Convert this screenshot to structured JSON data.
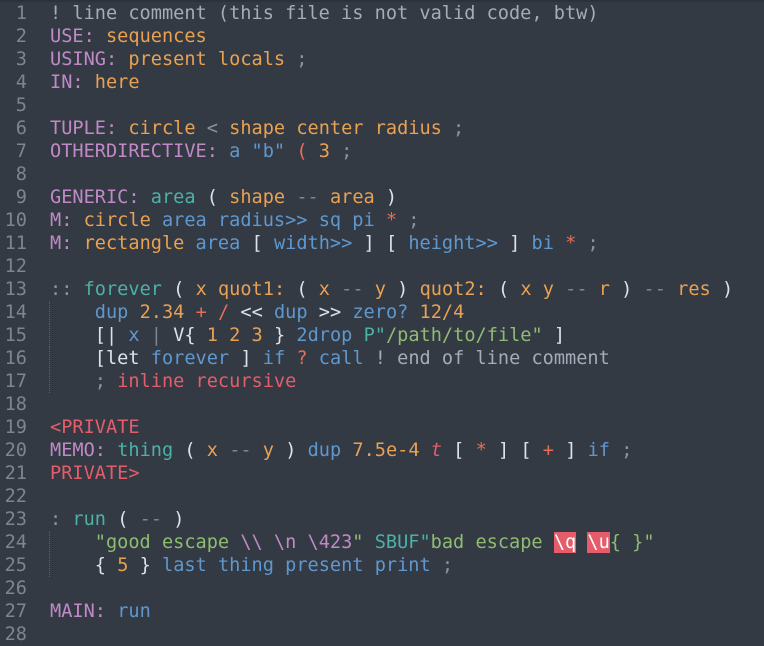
{
  "editor": {
    "theme_colors": {
      "background": "#343a44",
      "line_number": "#7d8590",
      "comment": "#a3acb8",
      "directive": "#c08ac6",
      "vocab": "#e9a152",
      "word": "#5f98cf",
      "definition_name": "#4cb1a8",
      "string": "#8fbc72",
      "operator": "#e66e59",
      "private": "#e55d6a",
      "bad_escape_bg": "#e55d6a"
    },
    "lines": [
      {
        "n": "1",
        "tokens": [
          {
            "t": "! line comment (this file is not valid code, btw)",
            "c": "comment"
          }
        ]
      },
      {
        "n": "2",
        "tokens": [
          {
            "t": "USE:",
            "c": "directive"
          },
          {
            "t": " ",
            "c": "plain"
          },
          {
            "t": "sequences",
            "c": "vocab"
          }
        ]
      },
      {
        "n": "3",
        "tokens": [
          {
            "t": "USING:",
            "c": "directive"
          },
          {
            "t": " ",
            "c": "plain"
          },
          {
            "t": "present locals",
            "c": "vocab"
          },
          {
            "t": " ;",
            "c": "dim"
          }
        ]
      },
      {
        "n": "4",
        "tokens": [
          {
            "t": "IN:",
            "c": "directive"
          },
          {
            "t": " ",
            "c": "plain"
          },
          {
            "t": "here",
            "c": "vocab"
          }
        ]
      },
      {
        "n": "5",
        "tokens": []
      },
      {
        "n": "6",
        "tokens": [
          {
            "t": "TUPLE:",
            "c": "directive"
          },
          {
            "t": " ",
            "c": "plain"
          },
          {
            "t": "circle",
            "c": "vocab"
          },
          {
            "t": " < ",
            "c": "dim"
          },
          {
            "t": "shape",
            "c": "vocab"
          },
          {
            "t": " ",
            "c": "plain"
          },
          {
            "t": "center radius",
            "c": "vocab"
          },
          {
            "t": " ;",
            "c": "dim"
          }
        ]
      },
      {
        "n": "7",
        "tokens": [
          {
            "t": "OTHERDIRECTIVE:",
            "c": "directive"
          },
          {
            "t": " ",
            "c": "plain"
          },
          {
            "t": "a",
            "c": "word"
          },
          {
            "t": " ",
            "c": "plain"
          },
          {
            "t": "\"b\"",
            "c": "word"
          },
          {
            "t": " ",
            "c": "plain"
          },
          {
            "t": "(",
            "c": "op"
          },
          {
            "t": " ",
            "c": "plain"
          },
          {
            "t": "3",
            "c": "number"
          },
          {
            "t": " ;",
            "c": "dim"
          }
        ]
      },
      {
        "n": "8",
        "tokens": []
      },
      {
        "n": "9",
        "tokens": [
          {
            "t": "GENERIC:",
            "c": "directive"
          },
          {
            "t": " ",
            "c": "plain"
          },
          {
            "t": "area",
            "c": "defname"
          },
          {
            "t": " ",
            "c": "plain"
          },
          {
            "t": "(",
            "c": "punct"
          },
          {
            "t": " ",
            "c": "plain"
          },
          {
            "t": "shape",
            "c": "stack"
          },
          {
            "t": " ",
            "c": "plain"
          },
          {
            "t": "--",
            "c": "dashes"
          },
          {
            "t": " ",
            "c": "plain"
          },
          {
            "t": "area",
            "c": "stack"
          },
          {
            "t": " ",
            "c": "plain"
          },
          {
            "t": ")",
            "c": "punct"
          }
        ]
      },
      {
        "n": "10",
        "tokens": [
          {
            "t": "M:",
            "c": "directive"
          },
          {
            "t": " ",
            "c": "plain"
          },
          {
            "t": "circle",
            "c": "vocab"
          },
          {
            "t": " ",
            "c": "plain"
          },
          {
            "t": "area radius>> sq pi",
            "c": "word"
          },
          {
            "t": " ",
            "c": "plain"
          },
          {
            "t": "*",
            "c": "op"
          },
          {
            "t": " ;",
            "c": "dim"
          }
        ]
      },
      {
        "n": "11",
        "tokens": [
          {
            "t": "M:",
            "c": "directive"
          },
          {
            "t": " ",
            "c": "plain"
          },
          {
            "t": "rectangle",
            "c": "vocab"
          },
          {
            "t": " ",
            "c": "plain"
          },
          {
            "t": "area",
            "c": "word"
          },
          {
            "t": " ",
            "c": "plain"
          },
          {
            "t": "[",
            "c": "punct"
          },
          {
            "t": " ",
            "c": "plain"
          },
          {
            "t": "width>>",
            "c": "word"
          },
          {
            "t": " ",
            "c": "plain"
          },
          {
            "t": "]",
            "c": "punct"
          },
          {
            "t": " ",
            "c": "plain"
          },
          {
            "t": "[",
            "c": "punct"
          },
          {
            "t": " ",
            "c": "plain"
          },
          {
            "t": "height>>",
            "c": "word"
          },
          {
            "t": " ",
            "c": "plain"
          },
          {
            "t": "]",
            "c": "punct"
          },
          {
            "t": " ",
            "c": "plain"
          },
          {
            "t": "bi",
            "c": "word"
          },
          {
            "t": " ",
            "c": "plain"
          },
          {
            "t": "*",
            "c": "op"
          },
          {
            "t": " ;",
            "c": "dim"
          }
        ]
      },
      {
        "n": "12",
        "tokens": []
      },
      {
        "n": "13",
        "tokens": [
          {
            "t": "::",
            "c": "dim"
          },
          {
            "t": " ",
            "c": "plain"
          },
          {
            "t": "forever",
            "c": "defname"
          },
          {
            "t": " ",
            "c": "plain"
          },
          {
            "t": "(",
            "c": "punct"
          },
          {
            "t": " ",
            "c": "plain"
          },
          {
            "t": "x quot1:",
            "c": "stack"
          },
          {
            "t": " ",
            "c": "plain"
          },
          {
            "t": "(",
            "c": "punct"
          },
          {
            "t": " ",
            "c": "plain"
          },
          {
            "t": "x",
            "c": "stack"
          },
          {
            "t": " ",
            "c": "plain"
          },
          {
            "t": "--",
            "c": "dashes"
          },
          {
            "t": " ",
            "c": "plain"
          },
          {
            "t": "y",
            "c": "stack"
          },
          {
            "t": " ",
            "c": "plain"
          },
          {
            "t": ")",
            "c": "punct"
          },
          {
            "t": " ",
            "c": "plain"
          },
          {
            "t": "quot2:",
            "c": "stack"
          },
          {
            "t": " ",
            "c": "plain"
          },
          {
            "t": "(",
            "c": "punct"
          },
          {
            "t": " ",
            "c": "plain"
          },
          {
            "t": "x y",
            "c": "stack"
          },
          {
            "t": " ",
            "c": "plain"
          },
          {
            "t": "--",
            "c": "dashes"
          },
          {
            "t": " ",
            "c": "plain"
          },
          {
            "t": "r",
            "c": "stack"
          },
          {
            "t": " ",
            "c": "plain"
          },
          {
            "t": ")",
            "c": "punct"
          },
          {
            "t": " ",
            "c": "plain"
          },
          {
            "t": "--",
            "c": "dashes"
          },
          {
            "t": " ",
            "c": "plain"
          },
          {
            "t": "res",
            "c": "stack"
          },
          {
            "t": " ",
            "c": "plain"
          },
          {
            "t": ")",
            "c": "punct"
          }
        ]
      },
      {
        "n": "14",
        "guide": true,
        "tokens": [
          {
            "t": "    ",
            "c": "plain"
          },
          {
            "t": "dup",
            "c": "word"
          },
          {
            "t": " ",
            "c": "plain"
          },
          {
            "t": "2.34",
            "c": "number"
          },
          {
            "t": " ",
            "c": "plain"
          },
          {
            "t": "+",
            "c": "op"
          },
          {
            "t": " ",
            "c": "plain"
          },
          {
            "t": "/",
            "c": "op"
          },
          {
            "t": " ",
            "c": "plain"
          },
          {
            "t": "<<",
            "c": "punct"
          },
          {
            "t": " ",
            "c": "plain"
          },
          {
            "t": "dup",
            "c": "word"
          },
          {
            "t": " ",
            "c": "plain"
          },
          {
            "t": ">>",
            "c": "punct"
          },
          {
            "t": " ",
            "c": "plain"
          },
          {
            "t": "zero?",
            "c": "word"
          },
          {
            "t": " ",
            "c": "plain"
          },
          {
            "t": "12/4",
            "c": "number"
          }
        ]
      },
      {
        "n": "15",
        "guide": true,
        "tokens": [
          {
            "t": "    ",
            "c": "plain"
          },
          {
            "t": "[|",
            "c": "punct"
          },
          {
            "t": " ",
            "c": "plain"
          },
          {
            "t": "x",
            "c": "word"
          },
          {
            "t": " ",
            "c": "plain"
          },
          {
            "t": "|",
            "c": "dashes"
          },
          {
            "t": " ",
            "c": "plain"
          },
          {
            "t": "V{",
            "c": "punct"
          },
          {
            "t": " ",
            "c": "plain"
          },
          {
            "t": "1 2 3",
            "c": "number"
          },
          {
            "t": " ",
            "c": "plain"
          },
          {
            "t": "}",
            "c": "punct"
          },
          {
            "t": " ",
            "c": "plain"
          },
          {
            "t": "2drop",
            "c": "word"
          },
          {
            "t": " ",
            "c": "plain"
          },
          {
            "t": "P\"",
            "c": "defname"
          },
          {
            "t": "/path/to/file\"",
            "c": "string"
          },
          {
            "t": " ",
            "c": "plain"
          },
          {
            "t": "]",
            "c": "punct"
          }
        ]
      },
      {
        "n": "16",
        "guide": true,
        "tokens": [
          {
            "t": "    ",
            "c": "plain"
          },
          {
            "t": "[let",
            "c": "punct"
          },
          {
            "t": " ",
            "c": "plain"
          },
          {
            "t": "forever",
            "c": "word"
          },
          {
            "t": " ",
            "c": "plain"
          },
          {
            "t": "]",
            "c": "punct"
          },
          {
            "t": " ",
            "c": "plain"
          },
          {
            "t": "if",
            "c": "word"
          },
          {
            "t": " ",
            "c": "plain"
          },
          {
            "t": "?",
            "c": "op"
          },
          {
            "t": " ",
            "c": "plain"
          },
          {
            "t": "call",
            "c": "word"
          },
          {
            "t": " ",
            "c": "plain"
          },
          {
            "t": "! end of line comment",
            "c": "comment"
          }
        ]
      },
      {
        "n": "17",
        "guide": true,
        "tokens": [
          {
            "t": "    ",
            "c": "plain"
          },
          {
            "t": ";",
            "c": "dim"
          },
          {
            "t": " ",
            "c": "plain"
          },
          {
            "t": "inline recursive",
            "c": "keyword"
          }
        ]
      },
      {
        "n": "18",
        "tokens": []
      },
      {
        "n": "19",
        "tokens": [
          {
            "t": "<PRIVATE",
            "c": "private"
          }
        ]
      },
      {
        "n": "20",
        "tokens": [
          {
            "t": "MEMO:",
            "c": "directive"
          },
          {
            "t": " ",
            "c": "plain"
          },
          {
            "t": "thing",
            "c": "defname"
          },
          {
            "t": " ",
            "c": "plain"
          },
          {
            "t": "(",
            "c": "punct"
          },
          {
            "t": " ",
            "c": "plain"
          },
          {
            "t": "x",
            "c": "stack"
          },
          {
            "t": " ",
            "c": "plain"
          },
          {
            "t": "--",
            "c": "dashes"
          },
          {
            "t": " ",
            "c": "plain"
          },
          {
            "t": "y",
            "c": "stack"
          },
          {
            "t": " ",
            "c": "plain"
          },
          {
            "t": ")",
            "c": "punct"
          },
          {
            "t": " ",
            "c": "plain"
          },
          {
            "t": "dup",
            "c": "word"
          },
          {
            "t": " ",
            "c": "plain"
          },
          {
            "t": "7.5e-4",
            "c": "number"
          },
          {
            "t": " ",
            "c": "plain"
          },
          {
            "t": "t",
            "c": "italic"
          },
          {
            "t": " ",
            "c": "plain"
          },
          {
            "t": "[",
            "c": "punct"
          },
          {
            "t": " ",
            "c": "plain"
          },
          {
            "t": "*",
            "c": "op"
          },
          {
            "t": " ",
            "c": "plain"
          },
          {
            "t": "]",
            "c": "punct"
          },
          {
            "t": " ",
            "c": "plain"
          },
          {
            "t": "[",
            "c": "punct"
          },
          {
            "t": " ",
            "c": "plain"
          },
          {
            "t": "+",
            "c": "op"
          },
          {
            "t": " ",
            "c": "plain"
          },
          {
            "t": "]",
            "c": "punct"
          },
          {
            "t": " ",
            "c": "plain"
          },
          {
            "t": "if",
            "c": "word"
          },
          {
            "t": " ;",
            "c": "dim"
          }
        ]
      },
      {
        "n": "21",
        "tokens": [
          {
            "t": "PRIVATE>",
            "c": "private"
          }
        ]
      },
      {
        "n": "22",
        "tokens": []
      },
      {
        "n": "23",
        "tokens": [
          {
            "t": ":",
            "c": "dim"
          },
          {
            "t": " ",
            "c": "plain"
          },
          {
            "t": "run",
            "c": "defname"
          },
          {
            "t": " ",
            "c": "plain"
          },
          {
            "t": "(",
            "c": "punct"
          },
          {
            "t": " ",
            "c": "plain"
          },
          {
            "t": "--",
            "c": "dashes"
          },
          {
            "t": " ",
            "c": "plain"
          },
          {
            "t": ")",
            "c": "punct"
          }
        ]
      },
      {
        "n": "24",
        "guide": true,
        "tokens": [
          {
            "t": "    ",
            "c": "plain"
          },
          {
            "t": "\"good escape ",
            "c": "string"
          },
          {
            "t": "\\\\",
            "c": "escape"
          },
          {
            "t": " ",
            "c": "string"
          },
          {
            "t": "\\n",
            "c": "escape"
          },
          {
            "t": " ",
            "c": "string"
          },
          {
            "t": "\\423",
            "c": "escape"
          },
          {
            "t": "\"",
            "c": "string"
          },
          {
            "t": " ",
            "c": "plain"
          },
          {
            "t": "SBUF\"",
            "c": "defname"
          },
          {
            "t": "bad escape ",
            "c": "string"
          },
          {
            "t": "\\q",
            "c": "bad"
          },
          {
            "t": " ",
            "c": "string"
          },
          {
            "t": "\\u",
            "c": "bad"
          },
          {
            "t": "{ }\"",
            "c": "string"
          }
        ]
      },
      {
        "n": "25",
        "guide": true,
        "tokens": [
          {
            "t": "    ",
            "c": "plain"
          },
          {
            "t": "{",
            "c": "punct"
          },
          {
            "t": " ",
            "c": "plain"
          },
          {
            "t": "5",
            "c": "number"
          },
          {
            "t": " ",
            "c": "plain"
          },
          {
            "t": "}",
            "c": "punct"
          },
          {
            "t": " ",
            "c": "plain"
          },
          {
            "t": "last thing present print",
            "c": "word"
          },
          {
            "t": " ;",
            "c": "dim"
          }
        ]
      },
      {
        "n": "26",
        "tokens": []
      },
      {
        "n": "27",
        "tokens": [
          {
            "t": "MAIN:",
            "c": "directive"
          },
          {
            "t": " ",
            "c": "plain"
          },
          {
            "t": "run",
            "c": "word"
          }
        ]
      },
      {
        "n": "28",
        "tokens": []
      }
    ]
  }
}
